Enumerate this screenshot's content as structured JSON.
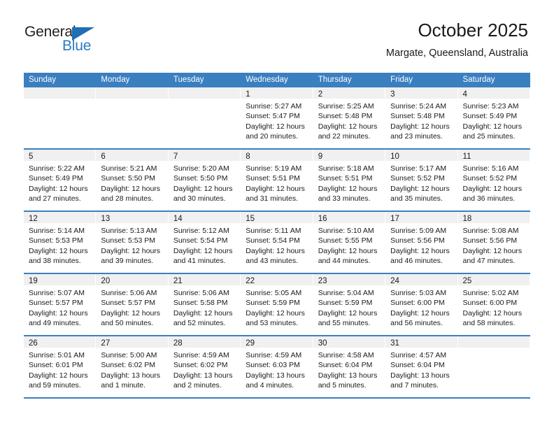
{
  "brand": {
    "name_part1": "General",
    "name_part2": "Blue",
    "triangle_color": "#1f6fb5",
    "blue_color": "#2b7cc4"
  },
  "header": {
    "title": "October 2025",
    "subtitle": "Margate, Queensland, Australia"
  },
  "theme": {
    "header_row_bg": "#3a7fc0",
    "day_band_bg": "#f0f0f0",
    "text_color": "#1a1a1a"
  },
  "weekday_headers": [
    "Sunday",
    "Monday",
    "Tuesday",
    "Wednesday",
    "Thursday",
    "Friday",
    "Saturday"
  ],
  "weeks": [
    [
      {
        "day": "",
        "empty": true
      },
      {
        "day": "",
        "empty": true
      },
      {
        "day": "",
        "empty": true
      },
      {
        "day": "1",
        "sunrise": "Sunrise: 5:27 AM",
        "sunset": "Sunset: 5:47 PM",
        "daylight1": "Daylight: 12 hours",
        "daylight2": "and 20 minutes."
      },
      {
        "day": "2",
        "sunrise": "Sunrise: 5:25 AM",
        "sunset": "Sunset: 5:48 PM",
        "daylight1": "Daylight: 12 hours",
        "daylight2": "and 22 minutes."
      },
      {
        "day": "3",
        "sunrise": "Sunrise: 5:24 AM",
        "sunset": "Sunset: 5:48 PM",
        "daylight1": "Daylight: 12 hours",
        "daylight2": "and 23 minutes."
      },
      {
        "day": "4",
        "sunrise": "Sunrise: 5:23 AM",
        "sunset": "Sunset: 5:49 PM",
        "daylight1": "Daylight: 12 hours",
        "daylight2": "and 25 minutes."
      }
    ],
    [
      {
        "day": "5",
        "sunrise": "Sunrise: 5:22 AM",
        "sunset": "Sunset: 5:49 PM",
        "daylight1": "Daylight: 12 hours",
        "daylight2": "and 27 minutes."
      },
      {
        "day": "6",
        "sunrise": "Sunrise: 5:21 AM",
        "sunset": "Sunset: 5:50 PM",
        "daylight1": "Daylight: 12 hours",
        "daylight2": "and 28 minutes."
      },
      {
        "day": "7",
        "sunrise": "Sunrise: 5:20 AM",
        "sunset": "Sunset: 5:50 PM",
        "daylight1": "Daylight: 12 hours",
        "daylight2": "and 30 minutes."
      },
      {
        "day": "8",
        "sunrise": "Sunrise: 5:19 AM",
        "sunset": "Sunset: 5:51 PM",
        "daylight1": "Daylight: 12 hours",
        "daylight2": "and 31 minutes."
      },
      {
        "day": "9",
        "sunrise": "Sunrise: 5:18 AM",
        "sunset": "Sunset: 5:51 PM",
        "daylight1": "Daylight: 12 hours",
        "daylight2": "and 33 minutes."
      },
      {
        "day": "10",
        "sunrise": "Sunrise: 5:17 AM",
        "sunset": "Sunset: 5:52 PM",
        "daylight1": "Daylight: 12 hours",
        "daylight2": "and 35 minutes."
      },
      {
        "day": "11",
        "sunrise": "Sunrise: 5:16 AM",
        "sunset": "Sunset: 5:52 PM",
        "daylight1": "Daylight: 12 hours",
        "daylight2": "and 36 minutes."
      }
    ],
    [
      {
        "day": "12",
        "sunrise": "Sunrise: 5:14 AM",
        "sunset": "Sunset: 5:53 PM",
        "daylight1": "Daylight: 12 hours",
        "daylight2": "and 38 minutes."
      },
      {
        "day": "13",
        "sunrise": "Sunrise: 5:13 AM",
        "sunset": "Sunset: 5:53 PM",
        "daylight1": "Daylight: 12 hours",
        "daylight2": "and 39 minutes."
      },
      {
        "day": "14",
        "sunrise": "Sunrise: 5:12 AM",
        "sunset": "Sunset: 5:54 PM",
        "daylight1": "Daylight: 12 hours",
        "daylight2": "and 41 minutes."
      },
      {
        "day": "15",
        "sunrise": "Sunrise: 5:11 AM",
        "sunset": "Sunset: 5:54 PM",
        "daylight1": "Daylight: 12 hours",
        "daylight2": "and 43 minutes."
      },
      {
        "day": "16",
        "sunrise": "Sunrise: 5:10 AM",
        "sunset": "Sunset: 5:55 PM",
        "daylight1": "Daylight: 12 hours",
        "daylight2": "and 44 minutes."
      },
      {
        "day": "17",
        "sunrise": "Sunrise: 5:09 AM",
        "sunset": "Sunset: 5:56 PM",
        "daylight1": "Daylight: 12 hours",
        "daylight2": "and 46 minutes."
      },
      {
        "day": "18",
        "sunrise": "Sunrise: 5:08 AM",
        "sunset": "Sunset: 5:56 PM",
        "daylight1": "Daylight: 12 hours",
        "daylight2": "and 47 minutes."
      }
    ],
    [
      {
        "day": "19",
        "sunrise": "Sunrise: 5:07 AM",
        "sunset": "Sunset: 5:57 PM",
        "daylight1": "Daylight: 12 hours",
        "daylight2": "and 49 minutes."
      },
      {
        "day": "20",
        "sunrise": "Sunrise: 5:06 AM",
        "sunset": "Sunset: 5:57 PM",
        "daylight1": "Daylight: 12 hours",
        "daylight2": "and 50 minutes."
      },
      {
        "day": "21",
        "sunrise": "Sunrise: 5:06 AM",
        "sunset": "Sunset: 5:58 PM",
        "daylight1": "Daylight: 12 hours",
        "daylight2": "and 52 minutes."
      },
      {
        "day": "22",
        "sunrise": "Sunrise: 5:05 AM",
        "sunset": "Sunset: 5:59 PM",
        "daylight1": "Daylight: 12 hours",
        "daylight2": "and 53 minutes."
      },
      {
        "day": "23",
        "sunrise": "Sunrise: 5:04 AM",
        "sunset": "Sunset: 5:59 PM",
        "daylight1": "Daylight: 12 hours",
        "daylight2": "and 55 minutes."
      },
      {
        "day": "24",
        "sunrise": "Sunrise: 5:03 AM",
        "sunset": "Sunset: 6:00 PM",
        "daylight1": "Daylight: 12 hours",
        "daylight2": "and 56 minutes."
      },
      {
        "day": "25",
        "sunrise": "Sunrise: 5:02 AM",
        "sunset": "Sunset: 6:00 PM",
        "daylight1": "Daylight: 12 hours",
        "daylight2": "and 58 minutes."
      }
    ],
    [
      {
        "day": "26",
        "sunrise": "Sunrise: 5:01 AM",
        "sunset": "Sunset: 6:01 PM",
        "daylight1": "Daylight: 12 hours",
        "daylight2": "and 59 minutes."
      },
      {
        "day": "27",
        "sunrise": "Sunrise: 5:00 AM",
        "sunset": "Sunset: 6:02 PM",
        "daylight1": "Daylight: 13 hours",
        "daylight2": "and 1 minute."
      },
      {
        "day": "28",
        "sunrise": "Sunrise: 4:59 AM",
        "sunset": "Sunset: 6:02 PM",
        "daylight1": "Daylight: 13 hours",
        "daylight2": "and 2 minutes."
      },
      {
        "day": "29",
        "sunrise": "Sunrise: 4:59 AM",
        "sunset": "Sunset: 6:03 PM",
        "daylight1": "Daylight: 13 hours",
        "daylight2": "and 4 minutes."
      },
      {
        "day": "30",
        "sunrise": "Sunrise: 4:58 AM",
        "sunset": "Sunset: 6:04 PM",
        "daylight1": "Daylight: 13 hours",
        "daylight2": "and 5 minutes."
      },
      {
        "day": "31",
        "sunrise": "Sunrise: 4:57 AM",
        "sunset": "Sunset: 6:04 PM",
        "daylight1": "Daylight: 13 hours",
        "daylight2": "and 7 minutes."
      },
      {
        "day": "",
        "empty": true
      }
    ]
  ]
}
